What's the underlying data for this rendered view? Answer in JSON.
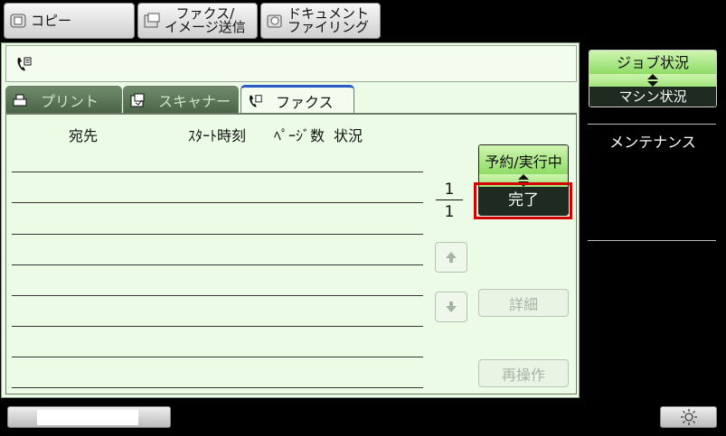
{
  "mode_buttons": [
    {
      "label": "コピー"
    },
    {
      "label": "ファクス/\nイメージ送信"
    },
    {
      "label": "ドキュメント\nファイリング"
    }
  ],
  "tabs": [
    {
      "label": "プリント"
    },
    {
      "label": "スキャナー"
    },
    {
      "label": "ファクス"
    }
  ],
  "columns": {
    "destination": "宛先",
    "start_time": "ｽﾀｰﾄ時刻",
    "pages": "ﾍﾟｰｼﾞ数",
    "status": "状況"
  },
  "pagination": {
    "current": "1",
    "total": "1"
  },
  "queue_toggle": {
    "top_label": "予約/実行中",
    "bottom_label": "完了"
  },
  "actions": {
    "detail_label": "詳細",
    "reprocess_label": "再操作"
  },
  "side_panel": {
    "job_toggle_top": "ジョブ状況",
    "job_toggle_bottom": "マシン状況",
    "maintenance_label": "メンテナンス"
  },
  "colors": {
    "highlight": "#d40000",
    "panel_bg": "#ecfbe6",
    "active_tab_border": "#2c57c8"
  }
}
